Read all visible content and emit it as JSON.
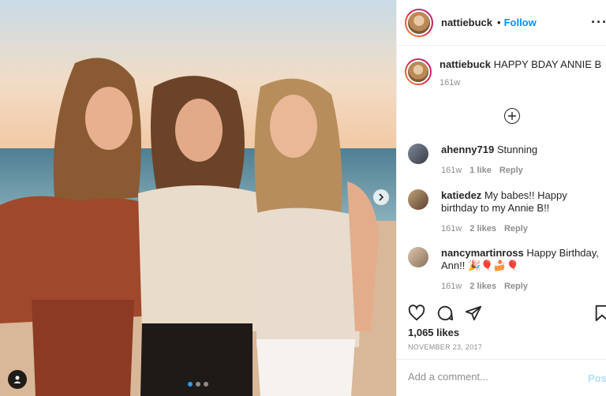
{
  "post": {
    "username": "nattiebuck",
    "follow_label": "Follow",
    "follow_separator": "•",
    "more_icon": "more-horizontal-icon"
  },
  "caption": {
    "username": "nattiebuck",
    "text": "HAPPY BDAY ANNIE B",
    "time": "161w"
  },
  "comments": [
    {
      "username": "ahenny719",
      "text": "Stunning",
      "time": "161w",
      "likes": "1 like",
      "reply": "Reply"
    },
    {
      "username": "katiedez",
      "text": "My babes!! Happy birthday to my Annie B!!",
      "time": "161w",
      "likes": "2 likes",
      "reply": "Reply"
    },
    {
      "username": "nancymartinross",
      "text": "Happy Birthday, Ann!! 🎉🎈🍰🎈",
      "time": "161w",
      "likes": "2 likes",
      "reply": "Reply"
    }
  ],
  "actions": {
    "likes": "1,065 likes",
    "date": "NOVEMBER 23, 2017"
  },
  "comment_box": {
    "placeholder": "Add a comment...",
    "post_label": "Post"
  },
  "carousel": {
    "slide_count": 3,
    "active_index": 0
  },
  "colors": {
    "accent": "#0095f6",
    "post_disabled": "#b2dffc",
    "muted": "#8e8e8e"
  }
}
